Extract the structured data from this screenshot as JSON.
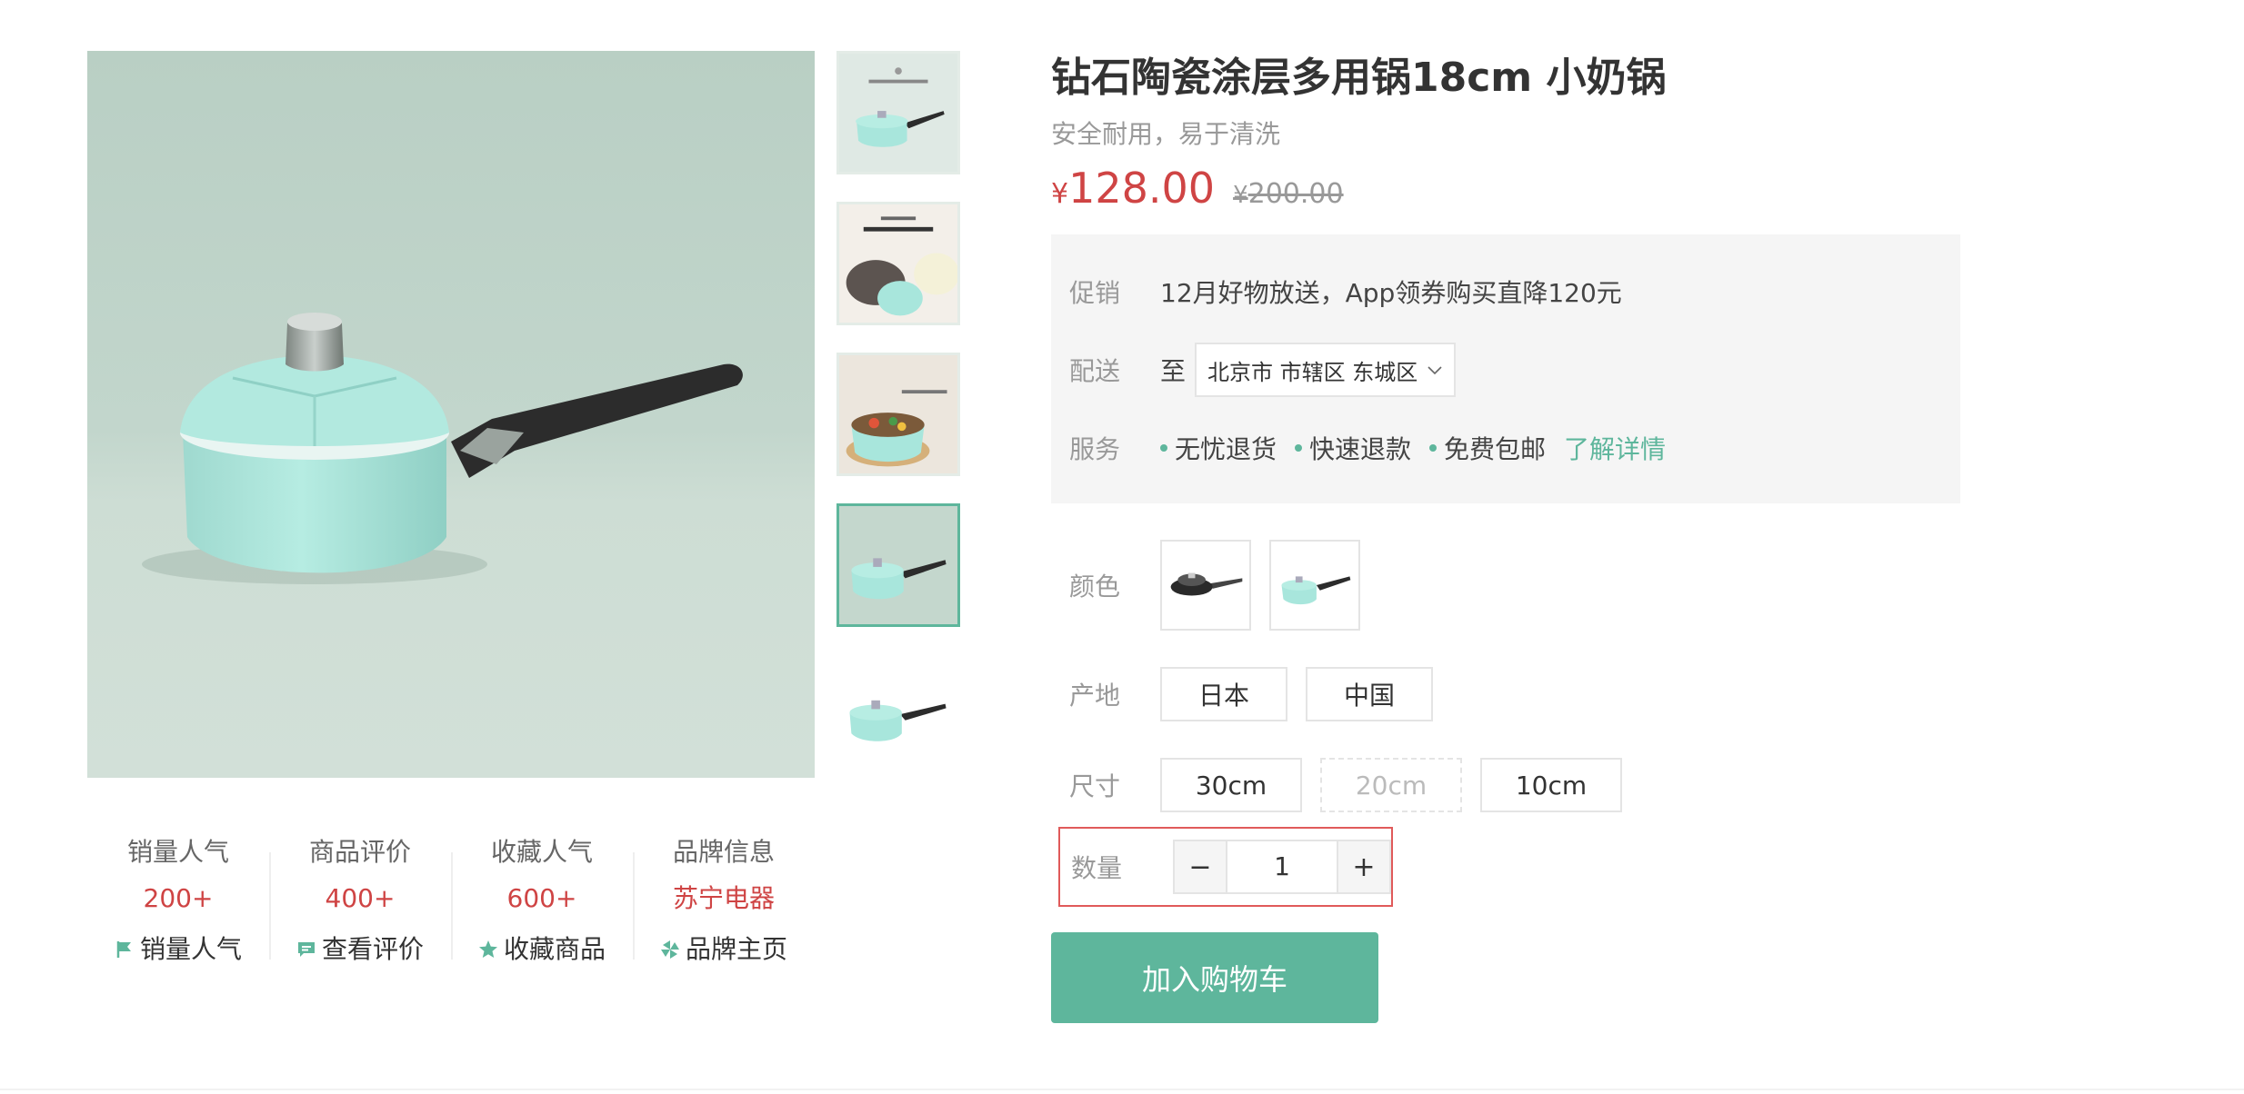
{
  "product": {
    "name": "钻石陶瓷涂层多用锅18cm 小奶锅",
    "desc": "安全耐用，易于清洗",
    "currency": "¥",
    "price": "128.00",
    "old_price": "200.00"
  },
  "stats": [
    {
      "title": "销量人气",
      "value": "200+",
      "link": "销量人气",
      "icon": "flag-icon"
    },
    {
      "title": "商品评价",
      "value": "400+",
      "link": "查看评价",
      "icon": "comment-icon"
    },
    {
      "title": "收藏人气",
      "value": "600+",
      "link": "收藏商品",
      "icon": "star-icon"
    },
    {
      "title": "品牌信息",
      "value": "苏宁电器",
      "link": "品牌主页",
      "icon": "brand-icon"
    }
  ],
  "promo": {
    "label": "促销",
    "text": "12月好物放送，App领券购买直降120元"
  },
  "delivery": {
    "label": "配送",
    "to": "至",
    "address": "北京市 市辖区 东城区"
  },
  "service": {
    "label": "服务",
    "items": [
      "无忧退货",
      "快速退款",
      "免费包邮"
    ],
    "more": "了解详情"
  },
  "specs": {
    "color_label": "颜色",
    "origin_label": "产地",
    "origins": [
      "日本",
      "中国"
    ],
    "size_label": "尺寸",
    "sizes": [
      "30cm",
      "20cm",
      "10cm"
    ]
  },
  "quantity": {
    "label": "数量",
    "minus": "−",
    "plus": "+",
    "value": "1"
  },
  "cart_button": "加入购物车",
  "colors": {
    "accent": "#5eb69c",
    "price": "#cf4444",
    "pot": "#a8e6dc",
    "handle": "#2c2c2c"
  }
}
